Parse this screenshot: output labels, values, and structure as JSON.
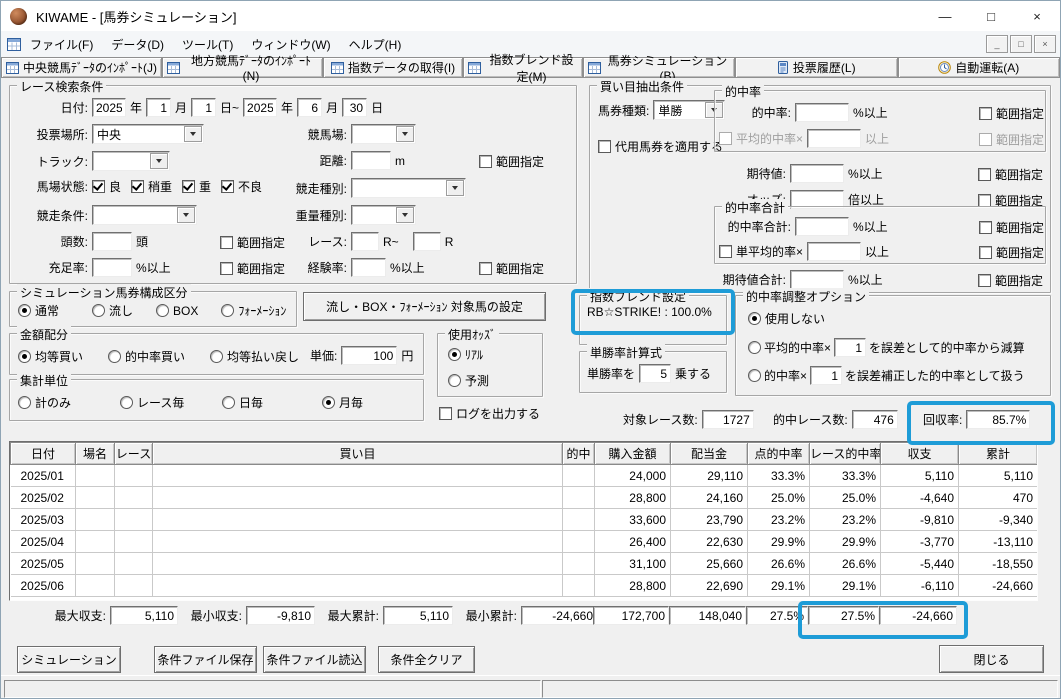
{
  "colors": {
    "highlight_blue": "#1E9CD7"
  },
  "window": {
    "title": "KIWAME - [馬券シミュレーション]",
    "controls": {
      "minimize": "—",
      "maximize": "□",
      "close": "×"
    },
    "mdi": {
      "minimize": "_",
      "restore": "□",
      "close": "×"
    }
  },
  "menu": {
    "items": [
      "ファイル(F)",
      "データ(D)",
      "ツール(T)",
      "ウィンドウ(W)",
      "ヘルプ(H)"
    ]
  },
  "toolbar": {
    "buttons": [
      "中央競馬ﾃﾞｰﾀのｲﾝﾎﾟｰﾄ(J)",
      "地方競馬ﾃﾞｰﾀのｲﾝﾎﾟｰﾄ(N)",
      "指数データの取得(I)",
      "指数ブレンド設定(M)",
      "馬券シミュレーション(B)",
      "投票履歴(L)",
      "自動運転(A)"
    ]
  },
  "search": {
    "title": "レース検索条件",
    "date": {
      "label": "日付:",
      "y1": "2025",
      "u_year": "年",
      "m1": "1",
      "u_month": "月",
      "d1": "1",
      "u_day_range": "日~",
      "y2": "2025",
      "m2": "6",
      "d2": "30",
      "u_day": "日"
    },
    "place": {
      "label": "投票場所:",
      "value": "中央"
    },
    "track": {
      "label": "トラック:",
      "value": ""
    },
    "course": {
      "label": "競馬場:",
      "value": ""
    },
    "distance": {
      "label": "距離:",
      "value": "",
      "unit": "m"
    },
    "surface": {
      "label": "馬場状態:",
      "options": [
        "良",
        "稍重",
        "重",
        "不良"
      ],
      "checked": [
        true,
        true,
        true,
        true
      ]
    },
    "race_cond": {
      "label": "競走条件:",
      "value": ""
    },
    "race_type": {
      "label": "競走種別:",
      "value": ""
    },
    "weight_type": {
      "label": "重量種別:",
      "value": ""
    },
    "heads": {
      "label": "頭数:",
      "value": "",
      "unit": "頭"
    },
    "race_no": {
      "label": "レース:",
      "from": "",
      "unit_from": "R~",
      "to": "",
      "unit_to": "R"
    },
    "fill_rate": {
      "label": "充足率:",
      "value": "",
      "unit": "%以上"
    },
    "exp_rate": {
      "label": "経験率:",
      "value": "",
      "unit": "%以上"
    },
    "range": "範囲指定"
  },
  "extract": {
    "title": "買い目抽出条件",
    "ticket": {
      "label": "馬券種類:",
      "value": "単勝"
    },
    "substitute": "代用馬券を適用する",
    "hit": {
      "group": "的中率",
      "label": "的中率:",
      "value": "",
      "unit": "%以上",
      "avg_label": "平均的中率×",
      "avg_value": "",
      "avg_unit": "以上"
    },
    "expect": {
      "label": "期待値:",
      "value": "",
      "unit": "%以上"
    },
    "odds": {
      "label": "オッズ:",
      "value": "",
      "unit": "倍以上"
    },
    "hitsum": {
      "group": "的中率合計",
      "label": "的中率合計:",
      "value": "",
      "unit": "%以上",
      "avg_label": "単平均的率×",
      "avg_value": "",
      "avg_unit": "以上"
    },
    "expectsum": {
      "label": "期待値合計:",
      "value": "",
      "unit": "%以上"
    },
    "range": "範囲指定"
  },
  "sim_type": {
    "title": "シミュレーション馬券構成区分",
    "options": [
      "通常",
      "流し",
      "BOX",
      "ﾌｫｰﾒｰｼｮﾝ"
    ],
    "selected": "通常"
  },
  "target_button": "流し・BOX・ﾌｫｰﾒｰｼｮﾝ 対象馬の設定",
  "amount": {
    "title": "金額配分",
    "options": [
      "均等買い",
      "的中率買い",
      "均等払い戻し"
    ],
    "selected": "均等買い",
    "unit_label": "単価:",
    "unit_value": "100",
    "unit_suffix": "円"
  },
  "use_odds": {
    "title": "使用ｵｯｽﾞ",
    "options": [
      "ﾘｱﾙ",
      "予測"
    ],
    "selected": "ﾘｱﾙ"
  },
  "aggregate": {
    "title": "集計単位",
    "options": [
      "計のみ",
      "レース毎",
      "日毎",
      "月毎"
    ],
    "selected": "月毎"
  },
  "log_output": "ログを出力する",
  "blend": {
    "title": "指数ブレンド設定",
    "value": "RB☆STRIKE! : 100.0%"
  },
  "win_calc": {
    "title": "単勝率計算式",
    "prefix": "単勝率を",
    "value": "5",
    "suffix": "乗する"
  },
  "adjust": {
    "title": "的中率調整オプション",
    "selected": "使用しない",
    "options": [
      {
        "pre": "使用しない",
        "value": "",
        "post": ""
      },
      {
        "pre": "平均的中率×",
        "value": "1",
        "post": "を誤差として的中率から減算"
      },
      {
        "pre": "的中率×",
        "value": "1",
        "post": "を誤差補正した的中率として扱う"
      }
    ]
  },
  "stats": {
    "races_label": "対象レース数:",
    "races": "1727",
    "hits_label": "的中レース数:",
    "hits": "476",
    "recovery_label": "回収率:",
    "recovery": "85.7%"
  },
  "table": {
    "headers": [
      "日付",
      "場名",
      "レース",
      "買い目",
      "的中",
      "購入金額",
      "配当金",
      "点的中率",
      "レース的中率",
      "収支",
      "累計"
    ],
    "rows": [
      [
        "2025/01",
        "",
        "",
        "",
        "",
        "24,000",
        "29,110",
        "33.3%",
        "33.3%",
        "5,110",
        "5,110"
      ],
      [
        "2025/02",
        "",
        "",
        "",
        "",
        "28,800",
        "24,160",
        "25.0%",
        "25.0%",
        "-4,640",
        "470"
      ],
      [
        "2025/03",
        "",
        "",
        "",
        "",
        "33,600",
        "23,790",
        "23.2%",
        "23.2%",
        "-9,810",
        "-9,340"
      ],
      [
        "2025/04",
        "",
        "",
        "",
        "",
        "26,400",
        "22,630",
        "29.9%",
        "29.9%",
        "-3,770",
        "-13,110"
      ],
      [
        "2025/05",
        "",
        "",
        "",
        "",
        "31,100",
        "25,660",
        "26.6%",
        "26.6%",
        "-5,440",
        "-18,550"
      ],
      [
        "2025/06",
        "",
        "",
        "",
        "",
        "28,800",
        "22,690",
        "29.1%",
        "29.1%",
        "-6,110",
        "-24,660"
      ]
    ]
  },
  "summary": {
    "max_profit_label": "最大収支:",
    "max_profit": "5,110",
    "min_profit_label": "最小収支:",
    "min_profit": "-9,810",
    "max_total_label": "最大累計:",
    "max_total": "5,110",
    "min_total_label": "最小累計:",
    "min_total": "-24,660",
    "purchase_total": "172,700",
    "payout_total": "148,040",
    "point_rate_total": "27.5%",
    "race_rate_total": "27.5%",
    "grand_total": "-24,660"
  },
  "footer": {
    "simulate": "シミュレーション",
    "save": "条件ファイル保存",
    "load": "条件ファイル読込",
    "clear": "条件全クリア",
    "close": "閉じる"
  }
}
